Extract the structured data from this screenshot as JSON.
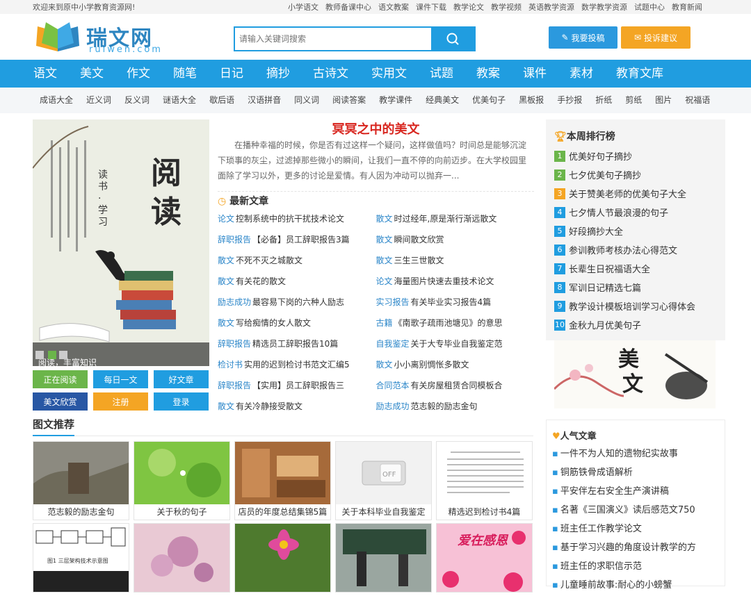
{
  "topbar": {
    "welcome": "欢迎来到原中小学教育资源网!",
    "links": [
      "小学语文",
      "教师备课中心",
      "语文教案",
      "课件下载",
      "教学论文",
      "教学视频",
      "英语教学资源",
      "数学教学资源",
      "试题中心",
      "教育新闻"
    ]
  },
  "logo": {
    "cn": "瑞文网",
    "en": "ruiwen.com"
  },
  "search": {
    "placeholder": "请输入关键词搜索"
  },
  "header_buttons": {
    "submit": "我要投稿",
    "complain": "投诉建议"
  },
  "nav": [
    "语文",
    "美文",
    "作文",
    "随笔",
    "日记",
    "摘抄",
    "古诗文",
    "实用文",
    "试题",
    "教案",
    "课件",
    "素材",
    "教育文库"
  ],
  "subnav": [
    "成语大全",
    "近义词",
    "反义词",
    "谜语大全",
    "歇后语",
    "汉语拼音",
    "同义词",
    "阅读答案",
    "教学课件",
    "经典美文",
    "优美句子",
    "黑板报",
    "手抄报",
    "折纸",
    "剪纸",
    "图片",
    "祝福语"
  ],
  "slide": {
    "big1": "阅",
    "big2": "读",
    "side": "读书·学习",
    "caption": "阅读，丰富知识"
  },
  "left_buttons": [
    "正在阅读",
    "每日一文",
    "好文章",
    "美文欣赏",
    "注册",
    "登录"
  ],
  "featured": {
    "title": "冥冥之中的美文",
    "text": "在播种幸福的时候，你是否有过这样一个疑问，这样做值吗？时间总是能够沉淀下琐事的灰尘，过滤掉那些微小的瞬间，让我们一直不停的向前迈步。在大学校园里面除了学习以外，更多的讨论是爱情。有人因为冲动可以抛弃一..."
  },
  "new_articles": {
    "heading": "最新文章",
    "items": [
      {
        "cat": "论文",
        "title": "控制系统中的抗干扰技术论文"
      },
      {
        "cat": "散文",
        "title": "时过经年,原是渐行渐远散文"
      },
      {
        "cat": "辞职报告",
        "title": "【必备】员工辞职报告3篇"
      },
      {
        "cat": "散文",
        "title": "瞬间散文欣赏"
      },
      {
        "cat": "散文",
        "title": "不死不灭之城散文"
      },
      {
        "cat": "散文",
        "title": "三生三世散文"
      },
      {
        "cat": "散文",
        "title": "有关花的散文"
      },
      {
        "cat": "论文",
        "title": "海量图片快速去重技术论文"
      },
      {
        "cat": "励志成功",
        "title": "最容易下岗的六种人励志"
      },
      {
        "cat": "实习报告",
        "title": "有关毕业实习报告4篇"
      },
      {
        "cat": "散文",
        "title": "写给痴情的女人散文"
      },
      {
        "cat": "古籍",
        "title": "《南歌子疏雨池塘见》的意思"
      },
      {
        "cat": "辞职报告",
        "title": "精选员工辞职报告10篇"
      },
      {
        "cat": "自我鉴定",
        "title": "关于大专毕业自我鉴定范"
      },
      {
        "cat": "检讨书",
        "title": "实用的迟到检讨书范文汇编5"
      },
      {
        "cat": "散文",
        "title": "小小离别惆怅多散文"
      },
      {
        "cat": "辞职报告",
        "title": "【实用】员工辞职报告三"
      },
      {
        "cat": "合同范本",
        "title": "有关房屋租赁合同模板合"
      },
      {
        "cat": "散文",
        "title": "有关冷静接受散文"
      },
      {
        "cat": "励志成功",
        "title": "范志毅的励志金句"
      }
    ]
  },
  "ranking": {
    "heading": "本周排行榜",
    "items": [
      "优美好句子摘抄",
      "七夕优美句子摘抄",
      "关于赞美老师的优美句子大全",
      "七夕情人节最浪漫的句子",
      "好段摘抄大全",
      "参训教师考核办法心得范文",
      "长辈生日祝福语大全",
      "军训日记精选七篇",
      "教学设计模板培训学习心得体会",
      "金秋九月优美句子"
    ]
  },
  "ad": {
    "text1": "美",
    "text2": "文"
  },
  "tuwen": {
    "heading": "图文推荐",
    "cards": [
      "范志毅的励志金句",
      "关于秋的句子",
      "店员的年度总结集锦5篇",
      "关于本科毕业自我鉴定",
      "精选迟到检讨书4篇"
    ],
    "second_row_text": "爱在感恩",
    "off_label": "OFF",
    "chart_label": "图1 三层架构技术示意图"
  },
  "hot": {
    "heading": "人气文章",
    "items": [
      "一件不为人知的遗物纪实故事",
      "铜筋铁骨成语解析",
      "平安伴左右安全生产演讲稿",
      "名著《三国演义》读后感范文750",
      "班主任工作教学论文",
      "基于学习兴趣的角度设计教学的方",
      "班主任的求职信示范",
      "儿童睡前故事:耐心的小螃蟹"
    ]
  },
  "colors": {
    "accent": "#209de0",
    "red_title": "#d8261f",
    "orange": "#f4a524",
    "green_btn": "#6bb54a",
    "navy_btn": "#2857a4"
  }
}
